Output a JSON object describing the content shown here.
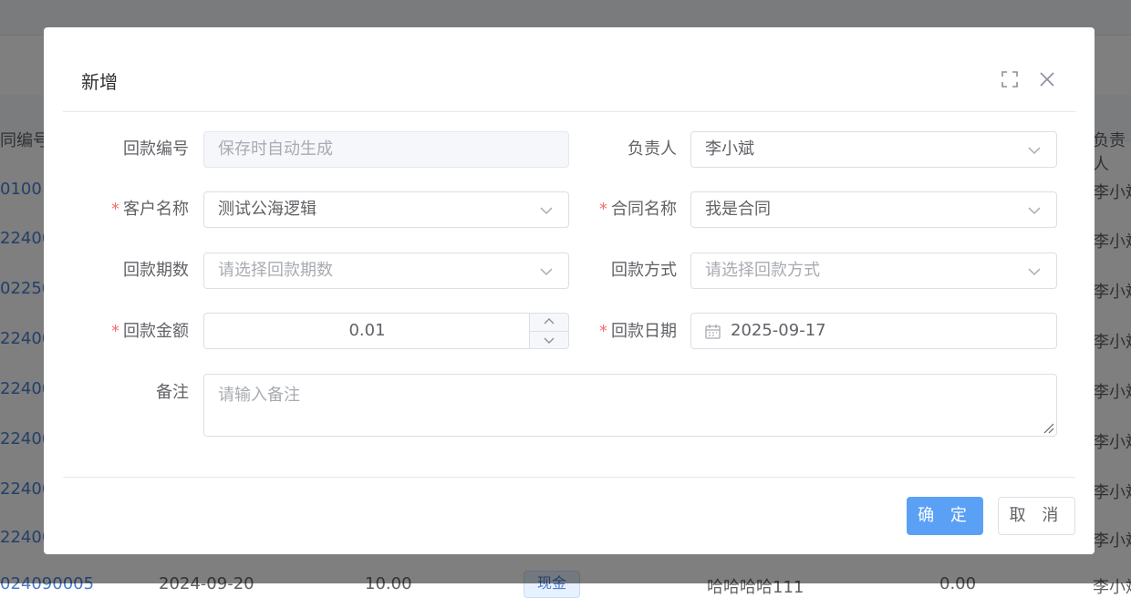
{
  "background": {
    "header_left": "同编号",
    "header_right": "负责人",
    "rows_left": [
      "0100",
      "22400",
      "02250",
      "22400",
      "22400",
      "22400",
      "22400",
      "22400"
    ],
    "rows_right": [
      "李小斌",
      "李小斌",
      "李小斌",
      "李小斌",
      "李小斌",
      "李小斌",
      "李小斌",
      "李小斌"
    ],
    "bottom_row": {
      "code": "024090005",
      "date": "2024-09-20",
      "amount": "10.00",
      "tag": "现金",
      "name": "哈哈哈哈111",
      "value": "0.00",
      "owner": "李小斌"
    }
  },
  "dialog": {
    "title": "新增",
    "icons": {
      "fullscreen": "fullscreen-icon",
      "close": "close-icon"
    },
    "form": {
      "payment_no": {
        "label": "回款编号",
        "placeholder": "保存时自动生成",
        "required": false
      },
      "owner": {
        "label": "负责人",
        "value": "李小斌",
        "required": false
      },
      "customer": {
        "label": "客户名称",
        "value": "测试公海逻辑",
        "required": true
      },
      "contract": {
        "label": "合同名称",
        "value": "我是合同",
        "required": true
      },
      "period": {
        "label": "回款期数",
        "placeholder": "请选择回款期数",
        "required": false
      },
      "method": {
        "label": "回款方式",
        "placeholder": "请选择回款方式",
        "required": false
      },
      "amount": {
        "label": "回款金额",
        "value": "0.01",
        "required": true
      },
      "date": {
        "label": "回款日期",
        "value": "2025-09-17",
        "required": true
      },
      "remark": {
        "label": "备注",
        "placeholder": "请输入备注",
        "required": false
      }
    },
    "required_mark": "*",
    "footer": {
      "confirm_label": "确 定",
      "cancel_label": "取 消"
    }
  },
  "colors": {
    "primary": "#5aa0f5",
    "required": "#f56c6c",
    "link": "#4a7fd0"
  }
}
